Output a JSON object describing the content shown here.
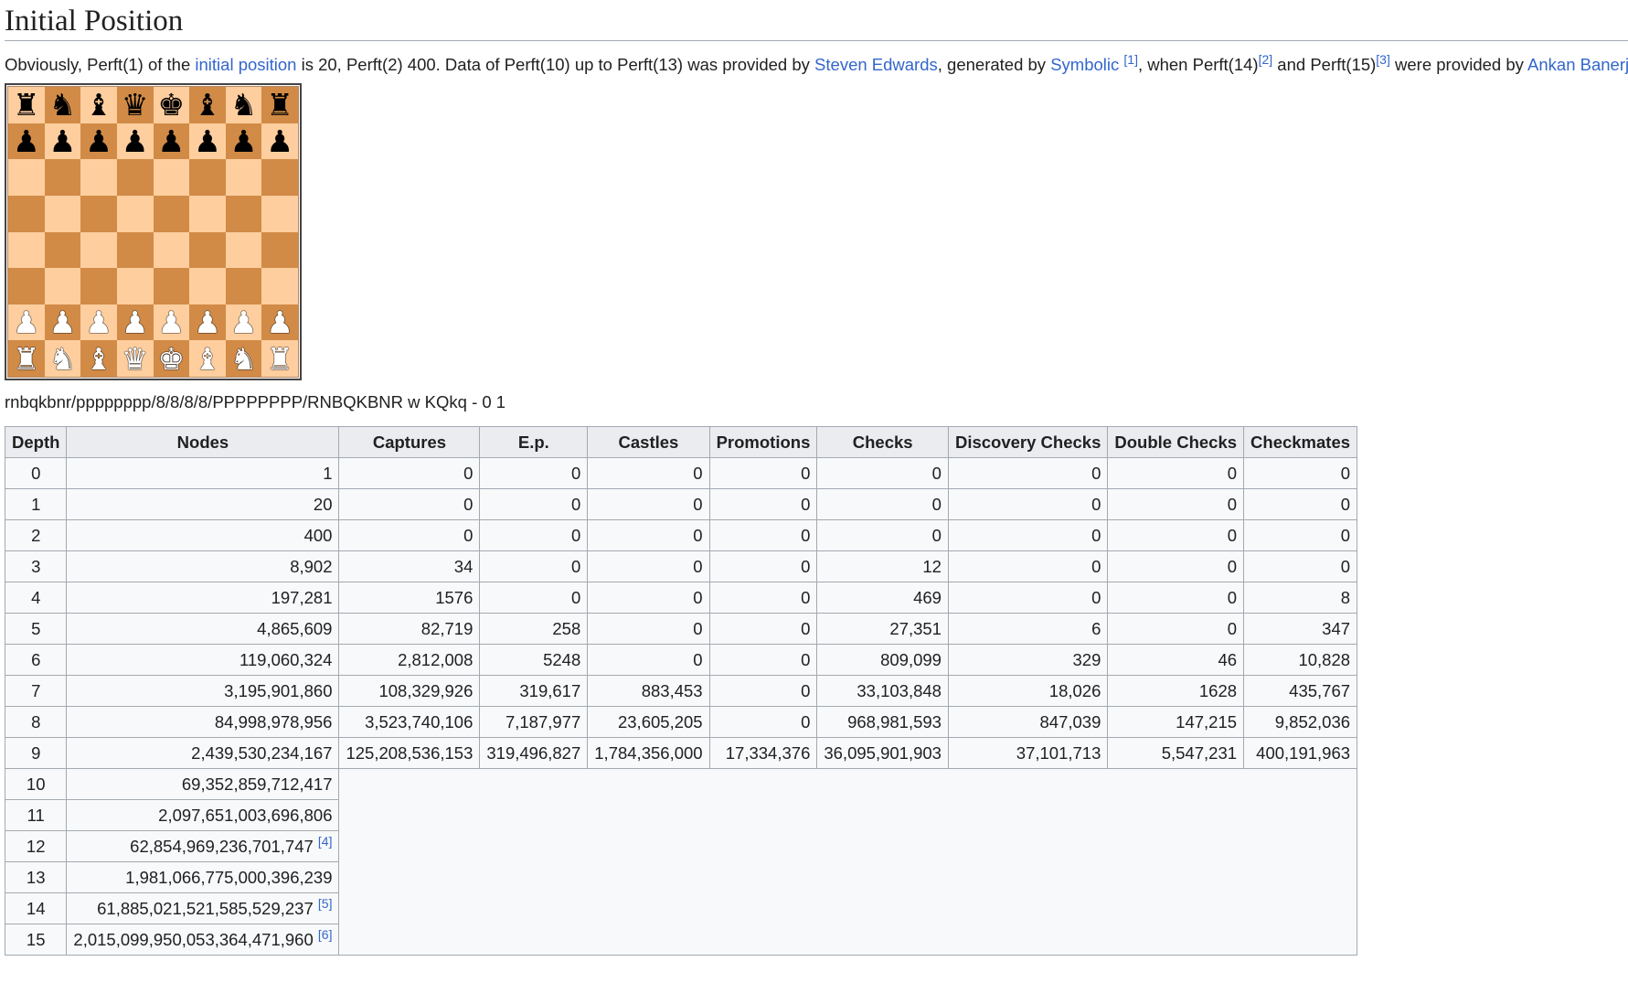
{
  "section": {
    "heading": "Initial Position"
  },
  "intro": {
    "t1": "Obviously, Perft(1) of the ",
    "link_initial_position": "initial position",
    "t2": " is 20, Perft(2) 400. Data of Perft(10) up to Perft(13) was provided by ",
    "link_steven_edwards": "Steven Edwards",
    "t3": ", generated by ",
    "link_symbolic": "Symbolic",
    "ref1": "[1]",
    "t4": ", when Perft(14)",
    "ref2": "[2]",
    "t5": " and Perft(15)",
    "ref3": "[3]",
    "t6": " were provided by ",
    "link_ankan_banerjee": "Ankan Banerjee",
    "t7": "."
  },
  "board": {
    "light_color": "#ffce9e",
    "dark_color": "#d18b47",
    "ranks": [
      [
        "black-rook",
        "black-knight",
        "black-bishop",
        "black-queen",
        "black-king",
        "black-bishop",
        "black-knight",
        "black-rook"
      ],
      [
        "black-pawn",
        "black-pawn",
        "black-pawn",
        "black-pawn",
        "black-pawn",
        "black-pawn",
        "black-pawn",
        "black-pawn"
      ],
      [
        "",
        "",
        "",
        "",
        "",
        "",
        "",
        ""
      ],
      [
        "",
        "",
        "",
        "",
        "",
        "",
        "",
        ""
      ],
      [
        "",
        "",
        "",
        "",
        "",
        "",
        "",
        ""
      ],
      [
        "",
        "",
        "",
        "",
        "",
        "",
        "",
        ""
      ],
      [
        "white-pawn",
        "white-pawn",
        "white-pawn",
        "white-pawn",
        "white-pawn",
        "white-pawn",
        "white-pawn",
        "white-pawn"
      ],
      [
        "white-rook",
        "white-knight",
        "white-bishop",
        "white-queen",
        "white-king",
        "white-bishop",
        "white-knight",
        "white-rook"
      ]
    ]
  },
  "fen": "rnbqkbnr/pppppppp/8/8/8/8/PPPPPPPP/RNBQKBNR w KQkq - 0 1",
  "table": {
    "headers": [
      "Depth",
      "Nodes",
      "Captures",
      "E.p.",
      "Castles",
      "Promotions",
      "Checks",
      "Discovery Checks",
      "Double Checks",
      "Checkmates"
    ],
    "rows": [
      {
        "depth": "0",
        "nodes": "1",
        "ref": "",
        "cells": [
          "0",
          "0",
          "0",
          "0",
          "0",
          "0",
          "0",
          "0"
        ]
      },
      {
        "depth": "1",
        "nodes": "20",
        "ref": "",
        "cells": [
          "0",
          "0",
          "0",
          "0",
          "0",
          "0",
          "0",
          "0"
        ]
      },
      {
        "depth": "2",
        "nodes": "400",
        "ref": "",
        "cells": [
          "0",
          "0",
          "0",
          "0",
          "0",
          "0",
          "0",
          "0"
        ]
      },
      {
        "depth": "3",
        "nodes": "8,902",
        "ref": "",
        "cells": [
          "34",
          "0",
          "0",
          "0",
          "12",
          "0",
          "0",
          "0"
        ]
      },
      {
        "depth": "4",
        "nodes": "197,281",
        "ref": "",
        "cells": [
          "1576",
          "0",
          "0",
          "0",
          "469",
          "0",
          "0",
          "8"
        ]
      },
      {
        "depth": "5",
        "nodes": "4,865,609",
        "ref": "",
        "cells": [
          "82,719",
          "258",
          "0",
          "0",
          "27,351",
          "6",
          "0",
          "347"
        ]
      },
      {
        "depth": "6",
        "nodes": "119,060,324",
        "ref": "",
        "cells": [
          "2,812,008",
          "5248",
          "0",
          "0",
          "809,099",
          "329",
          "46",
          "10,828"
        ]
      },
      {
        "depth": "7",
        "nodes": "3,195,901,860",
        "ref": "",
        "cells": [
          "108,329,926",
          "319,617",
          "883,453",
          "0",
          "33,103,848",
          "18,026",
          "1628",
          "435,767"
        ]
      },
      {
        "depth": "8",
        "nodes": "84,998,978,956",
        "ref": "",
        "cells": [
          "3,523,740,106",
          "7,187,977",
          "23,605,205",
          "0",
          "968,981,593",
          "847,039",
          "147,215",
          "9,852,036"
        ]
      },
      {
        "depth": "9",
        "nodes": "2,439,530,234,167",
        "ref": "",
        "cells": [
          "125,208,536,153",
          "319,496,827",
          "1,784,356,000",
          "17,334,376",
          "36,095,901,903",
          "37,101,713",
          "5,547,231",
          "400,191,963"
        ]
      },
      {
        "depth": "10",
        "nodes": "69,352,859,712,417",
        "ref": "",
        "cells": []
      },
      {
        "depth": "11",
        "nodes": "2,097,651,003,696,806",
        "ref": "",
        "cells": []
      },
      {
        "depth": "12",
        "nodes": "62,854,969,236,701,747",
        "ref": "[4]",
        "cells": []
      },
      {
        "depth": "13",
        "nodes": "1,981,066,775,000,396,239",
        "ref": "",
        "cells": []
      },
      {
        "depth": "14",
        "nodes": "61,885,021,521,585,529,237",
        "ref": "[5]",
        "cells": []
      },
      {
        "depth": "15",
        "nodes": "2,015,099,950,053,364,471,960",
        "ref": "[6]",
        "cells": []
      }
    ]
  }
}
